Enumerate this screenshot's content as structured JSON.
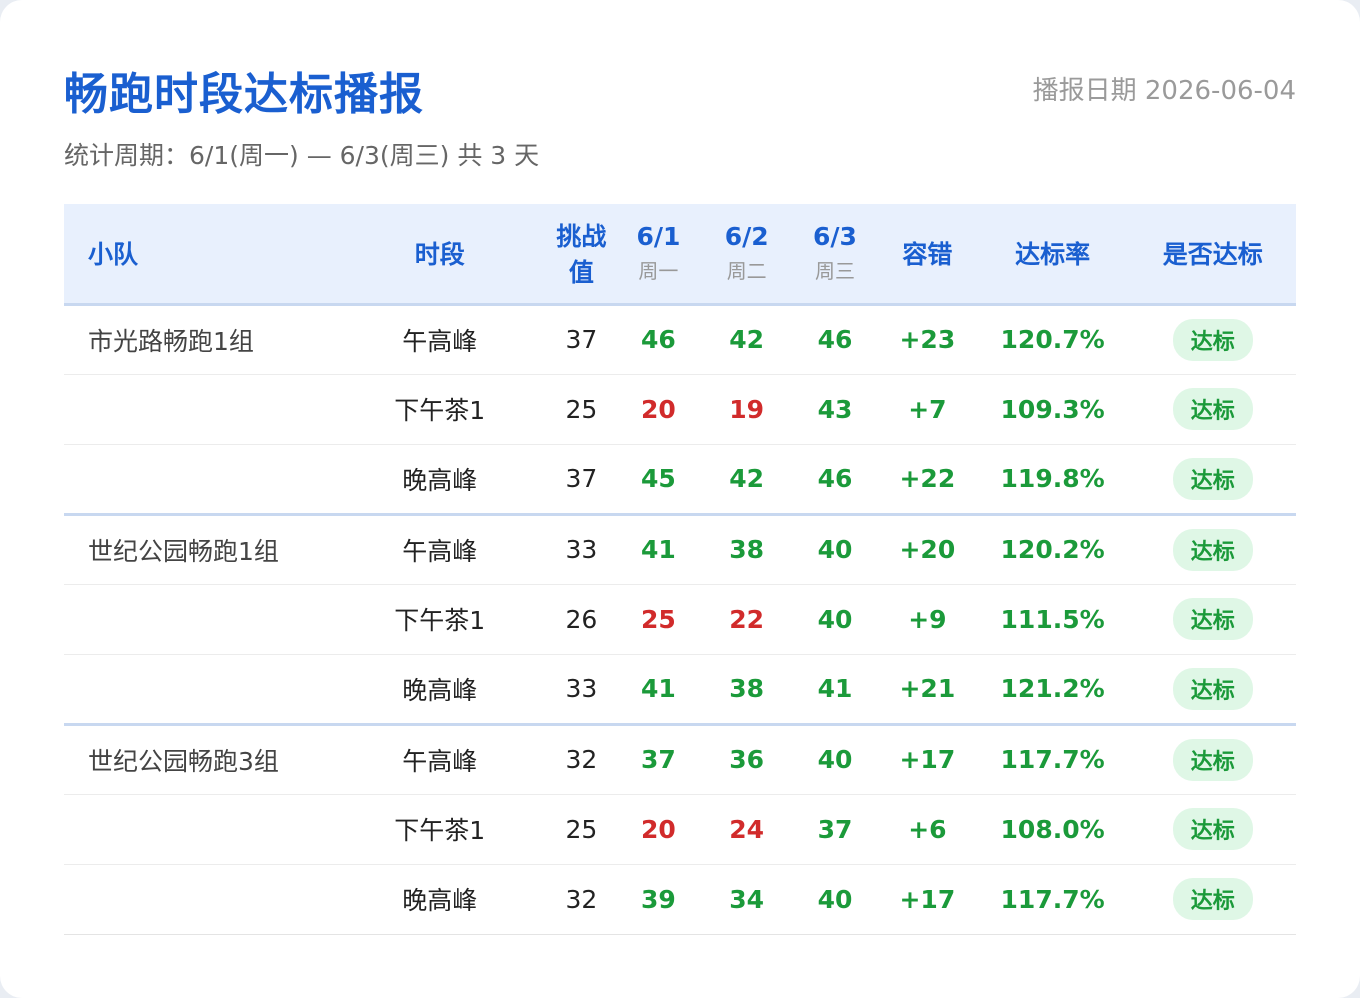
{
  "header": {
    "title": "畅跑时段达标播报",
    "date": "播报日期 2026-06-04",
    "period": "统计周期：6/1(周一) — 6/3(周三) 共 3 天"
  },
  "table": {
    "columns": {
      "team": "小队",
      "slot": "时段",
      "target": "挑战值",
      "days": [
        {
          "date": "6/1",
          "week": "周一"
        },
        {
          "date": "6/2",
          "week": "周二"
        },
        {
          "date": "6/3",
          "week": "周三"
        }
      ],
      "margin": "容错",
      "rate": "达标率",
      "status": "是否达标"
    },
    "groups": [
      {
        "team": "市光路畅跑1组",
        "rows": [
          {
            "slot": "午高峰",
            "target": "37",
            "days": [
              "46",
              "42",
              "46"
            ],
            "margin": "+23",
            "rate": "120.7%",
            "status": "达标"
          },
          {
            "slot": "下午茶1",
            "target": "25",
            "days": [
              "20",
              "19",
              "43"
            ],
            "margin": "+7",
            "rate": "109.3%",
            "status": "达标"
          },
          {
            "slot": "晚高峰",
            "target": "37",
            "days": [
              "45",
              "42",
              "46"
            ],
            "margin": "+22",
            "rate": "119.8%",
            "status": "达标"
          }
        ]
      },
      {
        "team": "世纪公园畅跑1组",
        "rows": [
          {
            "slot": "午高峰",
            "target": "33",
            "days": [
              "41",
              "38",
              "40"
            ],
            "margin": "+20",
            "rate": "120.2%",
            "status": "达标"
          },
          {
            "slot": "下午茶1",
            "target": "26",
            "days": [
              "25",
              "22",
              "40"
            ],
            "margin": "+9",
            "rate": "111.5%",
            "status": "达标"
          },
          {
            "slot": "晚高峰",
            "target": "33",
            "days": [
              "41",
              "38",
              "41"
            ],
            "margin": "+21",
            "rate": "121.2%",
            "status": "达标"
          }
        ]
      },
      {
        "team": "世纪公园畅跑3组",
        "rows": [
          {
            "slot": "午高峰",
            "target": "32",
            "days": [
              "37",
              "36",
              "40"
            ],
            "margin": "+17",
            "rate": "117.7%",
            "status": "达标"
          },
          {
            "slot": "下午茶1",
            "target": "25",
            "days": [
              "20",
              "24",
              "37"
            ],
            "margin": "+6",
            "rate": "108.0%",
            "status": "达标"
          },
          {
            "slot": "晚高峰",
            "target": "32",
            "days": [
              "39",
              "34",
              "40"
            ],
            "margin": "+17",
            "rate": "117.7%",
            "status": "达标"
          }
        ]
      }
    ]
  },
  "colors": {
    "accent": "#1a5fd0",
    "pass": "#1b9a3a",
    "fail": "#d12b2b"
  }
}
